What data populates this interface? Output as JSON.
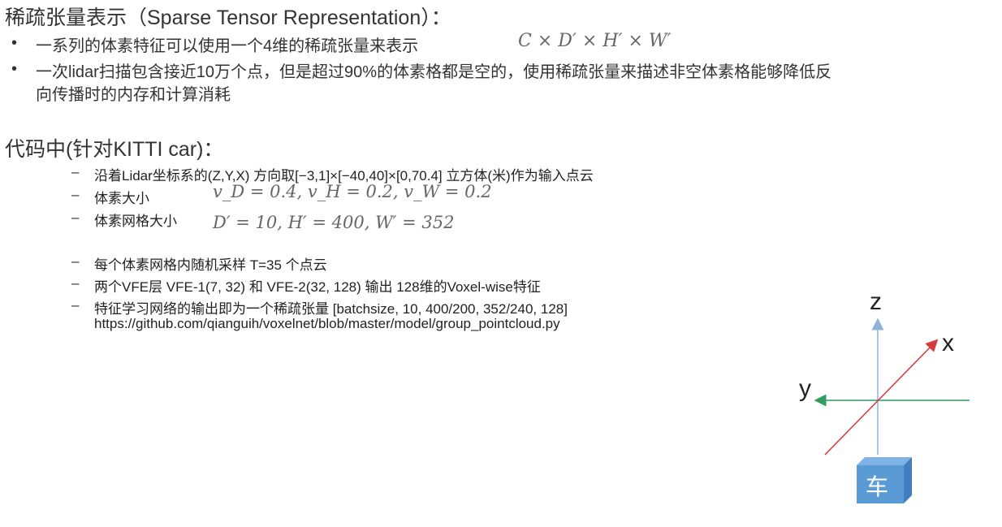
{
  "section1": {
    "title": "稀疏张量表示（Sparse Tensor Representation）：",
    "bullets": [
      {
        "text": "一系列的体素特征可以使用一个4维的稀疏张量来表示",
        "math": "C × D′ × H′ × W′"
      },
      {
        "text_line1": "一次lidar扫描包含接近10万个点，但是超过90%的体素格都是空的，使用稀疏张量来描述非空体素格能够降低反",
        "text_line2": "向传播时的内存和计算消耗"
      }
    ]
  },
  "section2": {
    "title": "代码中(针对KITTI car)：",
    "items": [
      {
        "text": "沿着Lidar坐标系的(Z,Y,X) 方向取[−3,1]×[−40,40]×[0,70.4] 立方体(米)作为输入点云"
      },
      {
        "text": "体素大小",
        "math": "v_D = 0.4, v_H = 0.2, v_W = 0.2"
      },
      {
        "text": "体素网格大小",
        "math": "D′ = 10, H′ = 400, W′ = 352"
      },
      {
        "text": "每个体素网格内随机采样 T=35 个点云"
      },
      {
        "text": "两个VFE层 VFE-1(7, 32) 和 VFE-2(32, 128) 输出 128维的Voxel-wise特征"
      },
      {
        "text": "特征学习网络的输出即为一个稀疏张量 [batchsize, 10, 400/200, 352/240, 128]",
        "link": "https://github.com/qianguih/voxelnet/blob/master/model/group_pointcloud.py"
      }
    ]
  },
  "diagram": {
    "z_label": "z",
    "x_label": "x",
    "y_label": "y",
    "cube_label": "车",
    "colors": {
      "z_axis": "#8fb3d9",
      "x_axis": "#d63a3a",
      "y_axis": "#2f9e5e",
      "cube": "#5b9bd5"
    }
  },
  "bullet_char": "•",
  "dash_char": "–"
}
